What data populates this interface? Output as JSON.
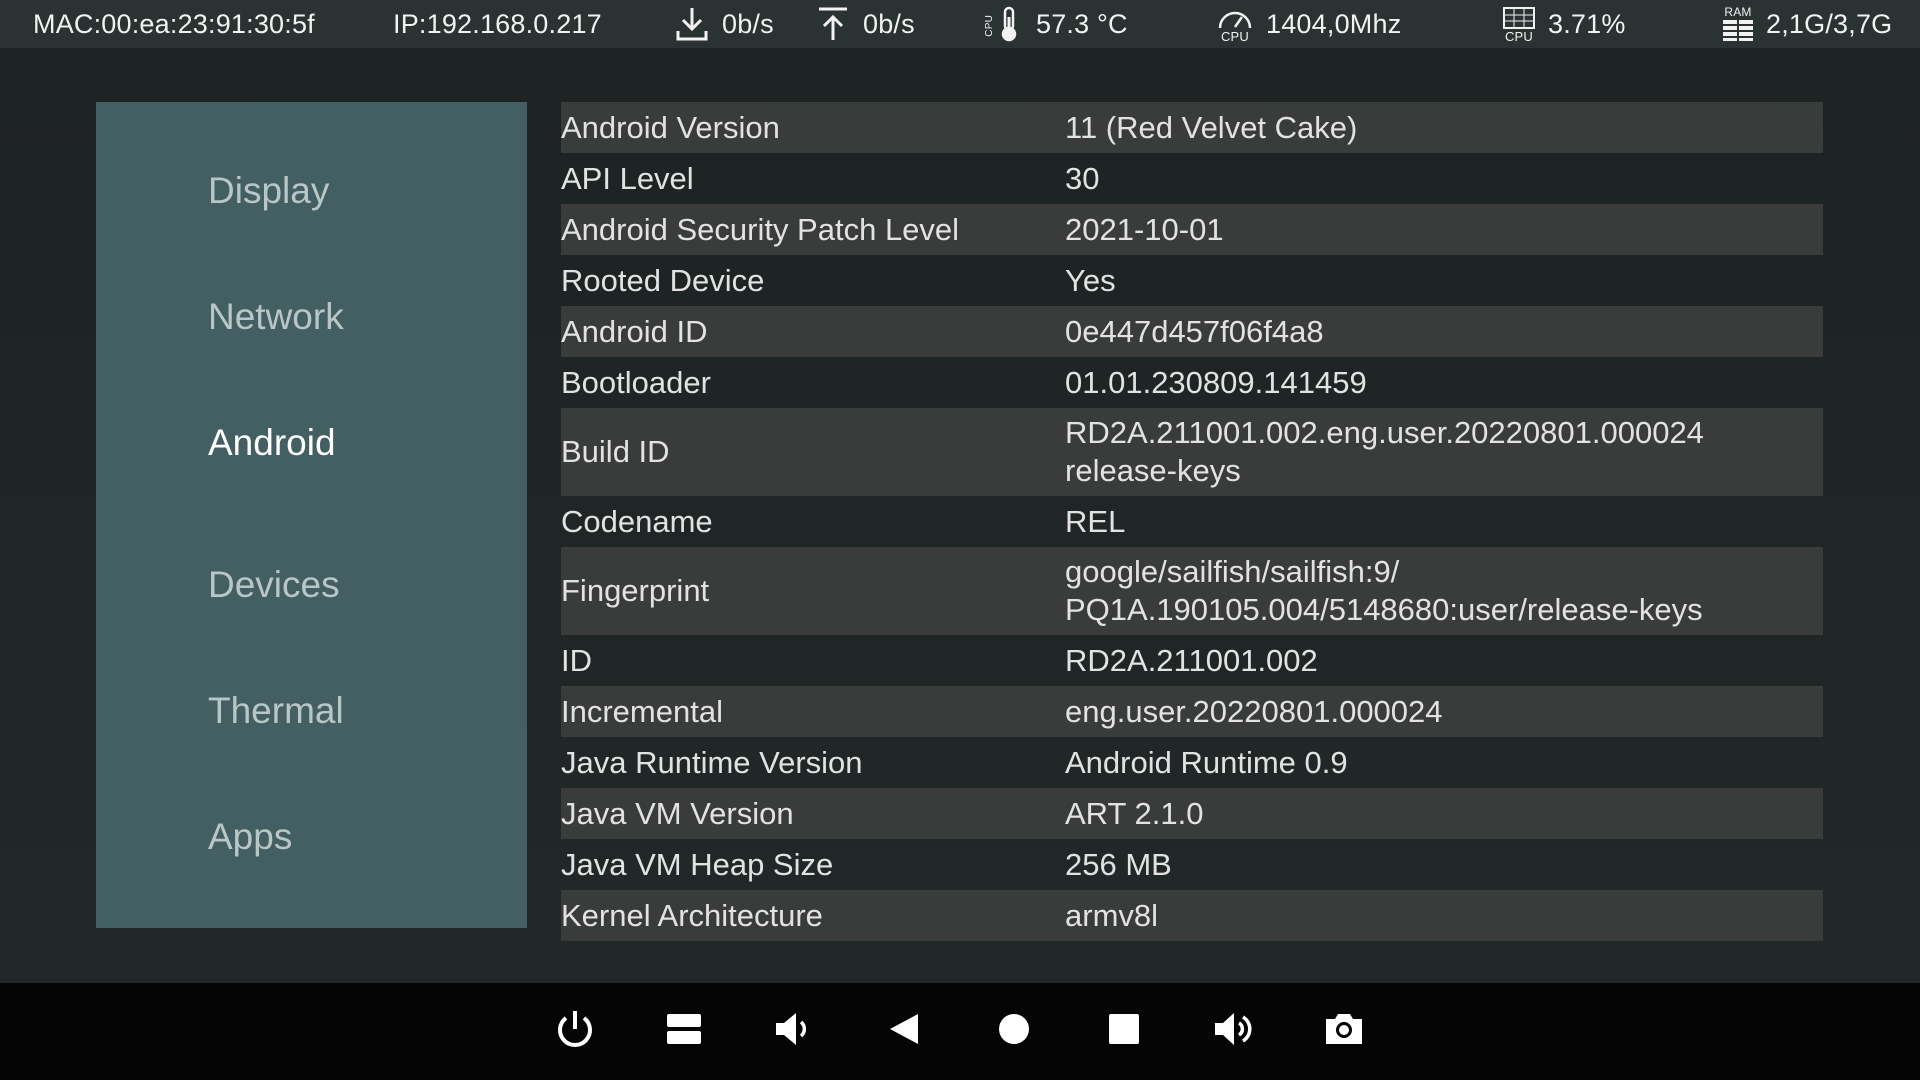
{
  "status_bar": {
    "mac": "MAC:00:ea:23:91:30:5f",
    "ip": "IP:192.168.0.217",
    "download_rate": "0b/s",
    "upload_rate": "0b/s",
    "temperature": "57.3 °C",
    "cpu_freq_icon_label": "CPU",
    "cpu_freq": "1404,0Mhz",
    "cpu_usage_icon_label": "CPU",
    "cpu_usage": "3.71%",
    "ram_icon_label": "RAM",
    "ram": "2,1G/3,7G",
    "temp_icon_label": "CPU"
  },
  "sidebar": {
    "items": [
      {
        "label": "Display",
        "active": false
      },
      {
        "label": "Network",
        "active": false
      },
      {
        "label": "Android",
        "active": true
      },
      {
        "label": "Devices",
        "active": false
      },
      {
        "label": "Thermal",
        "active": false
      },
      {
        "label": "Apps",
        "active": false
      }
    ]
  },
  "info_table": {
    "rows": [
      {
        "key": "Android Version",
        "value": [
          "11 (Red Velvet Cake)"
        ]
      },
      {
        "key": "API Level",
        "value": [
          "30"
        ]
      },
      {
        "key": "Android Security Patch Level",
        "value": [
          "2021-10-01"
        ]
      },
      {
        "key": "Rooted Device",
        "value": [
          "Yes"
        ]
      },
      {
        "key": "Android ID",
        "value": [
          "0e447d457f06f4a8"
        ]
      },
      {
        "key": "Bootloader",
        "value": [
          "01.01.230809.141459"
        ]
      },
      {
        "key": "Build ID",
        "value": [
          "RD2A.211001.002.eng.user.20220801.000024",
          "release-keys"
        ]
      },
      {
        "key": "Codename",
        "value": [
          "REL"
        ]
      },
      {
        "key": "Fingerprint",
        "value": [
          "google/sailfish/sailfish:9/",
          "PQ1A.190105.004/5148680:user/release-keys"
        ]
      },
      {
        "key": "ID",
        "value": [
          "RD2A.211001.002"
        ]
      },
      {
        "key": "Incremental",
        "value": [
          "eng.user.20220801.000024"
        ]
      },
      {
        "key": "Java Runtime Version",
        "value": [
          "Android Runtime 0.9"
        ]
      },
      {
        "key": "Java VM Version",
        "value": [
          "ART 2.1.0"
        ]
      },
      {
        "key": "Java VM Heap Size",
        "value": [
          "256 MB"
        ]
      },
      {
        "key": "Kernel Architecture",
        "value": [
          "armv8l"
        ]
      }
    ]
  },
  "nav_bar": {
    "buttons": [
      "power-icon",
      "recent-apps-icon",
      "volume-down-icon",
      "back-icon",
      "home-icon",
      "overview-icon",
      "volume-up-icon",
      "screenshot-icon"
    ]
  },
  "colors": {
    "status_bar_bg": "#2b3232",
    "sidebar_bg": "#435f62",
    "row_shade": "#3a3c3c",
    "nav_bar_bg": "#050505"
  }
}
